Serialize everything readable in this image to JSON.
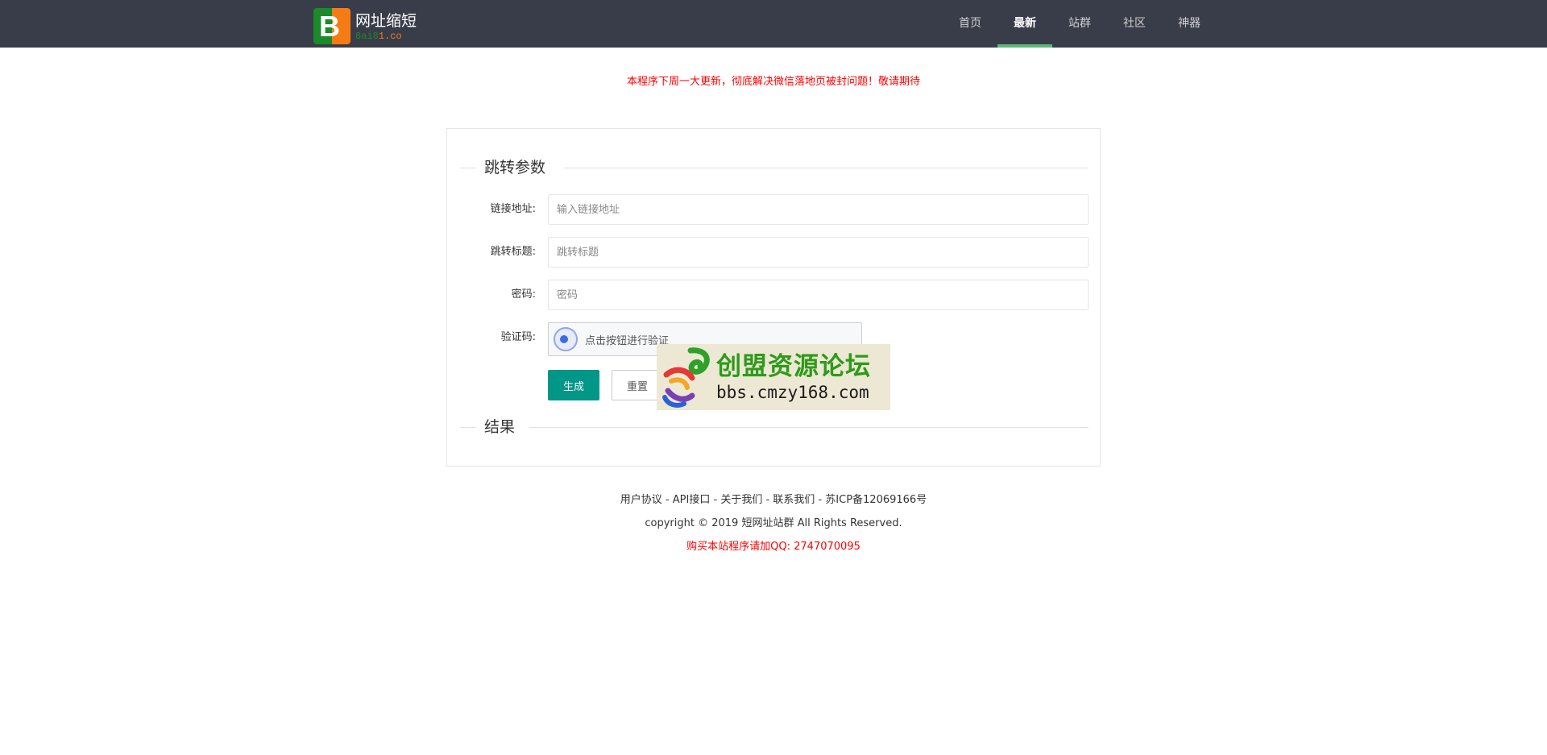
{
  "header": {
    "logo_letter": "B",
    "title": "网址缩短",
    "sub_a": "8ai8",
    "sub_b": "1.co",
    "nav": [
      {
        "label": "首页"
      },
      {
        "label": "最新"
      },
      {
        "label": "站群"
      },
      {
        "label": "社区"
      },
      {
        "label": "神器"
      }
    ],
    "active_nav": "最新"
  },
  "notice": "本程序下周一大更新，彻底解决微信落地页被封问题！敬请期待",
  "form": {
    "section_title": "跳转参数",
    "url_label": "链接地址:",
    "url_placeholder": "输入链接地址",
    "title_label": "跳转标题:",
    "title_placeholder": "跳转标题",
    "password_label": "密码:",
    "password_placeholder": "密码",
    "captcha_label": "验证码:",
    "captcha_text": "点击按钮进行验证",
    "generate_label": "生成",
    "reset_label": "重置",
    "result_title": "结果"
  },
  "watermark": {
    "cn": "创盟资源论坛",
    "en": "bbs.cmzy168.com"
  },
  "footer": {
    "links": [
      "用户协议",
      "API接口",
      "关于我们",
      "联系我们",
      "苏ICP备12069166号"
    ],
    "separator": " - ",
    "copyright": "copyright © 2019 短网址站群 All Rights Reserved.",
    "buy": "购买本站程序请加QQ: 2747070095"
  },
  "colors": {
    "header_bg": "#393d49",
    "nav_active_bar": "#5fb878",
    "primary_button": "#009688",
    "notice": "#ff0000"
  }
}
